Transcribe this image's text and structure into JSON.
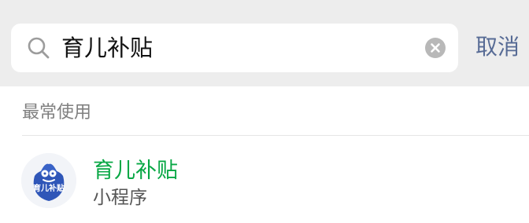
{
  "search": {
    "query": "育儿补贴",
    "cancel_label": "取消",
    "icon": "search-icon",
    "clear_icon": "clear-icon"
  },
  "section": {
    "title": "最常使用"
  },
  "results": [
    {
      "title": "育儿补贴",
      "subtitle": "小程序",
      "logo_text": "育儿补贴",
      "title_color": "#07a744"
    }
  ],
  "colors": {
    "header_background": "#ededed",
    "link": "#576b95",
    "logo_blue": "#2f56b8"
  }
}
